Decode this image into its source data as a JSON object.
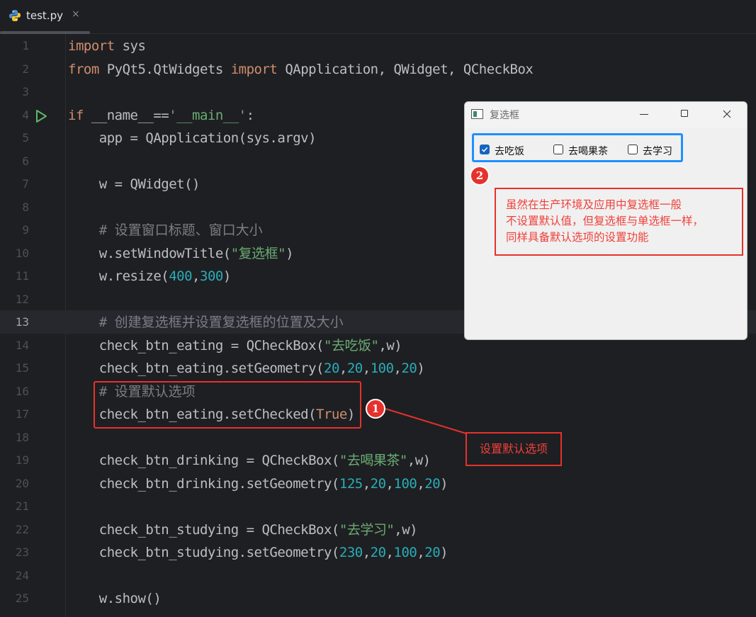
{
  "tab": {
    "filename": "test.py",
    "close_glyph": "×"
  },
  "editor": {
    "current_line": 13,
    "lines": [
      {
        "n": "1",
        "tokens": [
          {
            "t": "import",
            "c": "kw"
          },
          {
            "t": " sys",
            "c": ""
          }
        ]
      },
      {
        "n": "2",
        "tokens": [
          {
            "t": "from",
            "c": "kw"
          },
          {
            "t": " PyQt5.QtWidgets ",
            "c": ""
          },
          {
            "t": "import",
            "c": "kw"
          },
          {
            "t": " QApplication, QWidget, QCheckBox",
            "c": ""
          }
        ]
      },
      {
        "n": "3",
        "tokens": []
      },
      {
        "n": "4",
        "tokens": [
          {
            "t": "if",
            "c": "kw"
          },
          {
            "t": " __name__==",
            "c": ""
          },
          {
            "t": "'__main__'",
            "c": "str"
          },
          {
            "t": ":",
            "c": ""
          }
        ]
      },
      {
        "n": "5",
        "tokens": [
          {
            "t": "    app = QApplication(sys.argv)",
            "c": ""
          }
        ]
      },
      {
        "n": "6",
        "tokens": []
      },
      {
        "n": "7",
        "tokens": [
          {
            "t": "    w = QWidget()",
            "c": ""
          }
        ]
      },
      {
        "n": "8",
        "tokens": []
      },
      {
        "n": "9",
        "tokens": [
          {
            "t": "    # ",
            "c": "com"
          },
          {
            "t": "设置窗口标题、窗口大小",
            "c": "com cjk"
          }
        ]
      },
      {
        "n": "10",
        "tokens": [
          {
            "t": "    w.setWindowTitle(",
            "c": ""
          },
          {
            "t": "\"复选框\"",
            "c": "str"
          },
          {
            "t": ")",
            "c": ""
          }
        ]
      },
      {
        "n": "11",
        "tokens": [
          {
            "t": "    w.resize(",
            "c": ""
          },
          {
            "t": "400",
            "c": "num"
          },
          {
            "t": ",",
            "c": ""
          },
          {
            "t": "300",
            "c": "num"
          },
          {
            "t": ")",
            "c": ""
          }
        ]
      },
      {
        "n": "12",
        "tokens": []
      },
      {
        "n": "13",
        "tokens": [
          {
            "t": "    # ",
            "c": "com"
          },
          {
            "t": "创建复选框并设置复选框的位置及大小",
            "c": "com cjk"
          }
        ]
      },
      {
        "n": "14",
        "tokens": [
          {
            "t": "    check_btn_eating = QCheckBox(",
            "c": ""
          },
          {
            "t": "\"去吃饭\"",
            "c": "str"
          },
          {
            "t": ",w)",
            "c": ""
          }
        ]
      },
      {
        "n": "15",
        "tokens": [
          {
            "t": "    check_btn_eating.setGeometry(",
            "c": ""
          },
          {
            "t": "20",
            "c": "num"
          },
          {
            "t": ",",
            "c": ""
          },
          {
            "t": "20",
            "c": "num"
          },
          {
            "t": ",",
            "c": ""
          },
          {
            "t": "100",
            "c": "num"
          },
          {
            "t": ",",
            "c": ""
          },
          {
            "t": "20",
            "c": "num"
          },
          {
            "t": ")",
            "c": ""
          }
        ]
      },
      {
        "n": "16",
        "tokens": [
          {
            "t": "    # ",
            "c": "com"
          },
          {
            "t": "设置默认选项",
            "c": "com cjk"
          }
        ]
      },
      {
        "n": "17",
        "tokens": [
          {
            "t": "    check_btn_eating.setChecked(",
            "c": ""
          },
          {
            "t": "True",
            "c": "kw"
          },
          {
            "t": ")",
            "c": ""
          }
        ]
      },
      {
        "n": "18",
        "tokens": []
      },
      {
        "n": "19",
        "tokens": [
          {
            "t": "    check_btn_drinking = QCheckBox(",
            "c": ""
          },
          {
            "t": "\"去喝果茶\"",
            "c": "str"
          },
          {
            "t": ",w)",
            "c": ""
          }
        ]
      },
      {
        "n": "20",
        "tokens": [
          {
            "t": "    check_btn_drinking.setGeometry(",
            "c": ""
          },
          {
            "t": "125",
            "c": "num"
          },
          {
            "t": ",",
            "c": ""
          },
          {
            "t": "20",
            "c": "num"
          },
          {
            "t": ",",
            "c": ""
          },
          {
            "t": "100",
            "c": "num"
          },
          {
            "t": ",",
            "c": ""
          },
          {
            "t": "20",
            "c": "num"
          },
          {
            "t": ")",
            "c": ""
          }
        ]
      },
      {
        "n": "21",
        "tokens": []
      },
      {
        "n": "22",
        "tokens": [
          {
            "t": "    check_btn_studying = QCheckBox(",
            "c": ""
          },
          {
            "t": "\"去学习\"",
            "c": "str"
          },
          {
            "t": ",w)",
            "c": ""
          }
        ]
      },
      {
        "n": "23",
        "tokens": [
          {
            "t": "    check_btn_studying.setGeometry(",
            "c": ""
          },
          {
            "t": "230",
            "c": "num"
          },
          {
            "t": ",",
            "c": ""
          },
          {
            "t": "20",
            "c": "num"
          },
          {
            "t": ",",
            "c": ""
          },
          {
            "t": "100",
            "c": "num"
          },
          {
            "t": ",",
            "c": ""
          },
          {
            "t": "20",
            "c": "num"
          },
          {
            "t": ")",
            "c": ""
          }
        ]
      },
      {
        "n": "24",
        "tokens": []
      },
      {
        "n": "25",
        "tokens": [
          {
            "t": "    w.show()",
            "c": ""
          }
        ]
      }
    ]
  },
  "annotation1": {
    "badge": "1",
    "text": "设置默认选项"
  },
  "qt_window": {
    "title": "复选框",
    "checkboxes": [
      {
        "label": "去吃饭",
        "checked": true
      },
      {
        "label": "去喝果茶",
        "checked": false
      },
      {
        "label": "去学习",
        "checked": false
      }
    ]
  },
  "annotation2": {
    "badge": "2",
    "lines": [
      "虽然在生产环境及应用中复选框一般",
      "不设置默认值，但复选框与单选框一样，",
      "同样具备默认选项的设置功能"
    ]
  },
  "colors": {
    "keyword": "#cf8e6d",
    "string": "#6aab73",
    "number": "#2aacb8",
    "comment": "#7a7e85",
    "annotation_red": "#e5322d",
    "highlight_blue": "#1e90ff",
    "checkbox_blue": "#1565c0"
  },
  "icons": {
    "tab": "python-file-icon",
    "gutter": "run-icon"
  }
}
